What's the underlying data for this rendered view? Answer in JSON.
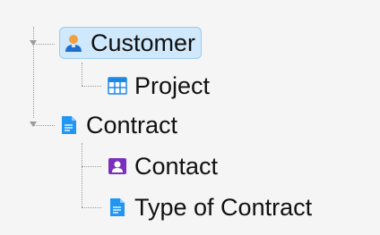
{
  "tree": {
    "nodes": [
      {
        "id": "customer",
        "label": "Customer",
        "icon": "person-icon",
        "selected": true
      },
      {
        "id": "project",
        "label": "Project",
        "icon": "table-icon"
      },
      {
        "id": "contract",
        "label": "Contract",
        "icon": "document-icon"
      },
      {
        "id": "contact",
        "label": "Contact",
        "icon": "contact-card-icon"
      },
      {
        "id": "type-of-contract",
        "label": "Type of Contract",
        "icon": "document-icon"
      }
    ]
  },
  "colors": {
    "selection_fill": "#cfe8fb",
    "selection_border": "#9ccbee",
    "connector": "#9a9a9a",
    "person_icon_body": "#1f6fd1",
    "person_icon_head": "#f0a040",
    "table_icon": "#1e88e5",
    "document_icon": "#2196f3",
    "contact_icon": "#7b2fbf"
  }
}
